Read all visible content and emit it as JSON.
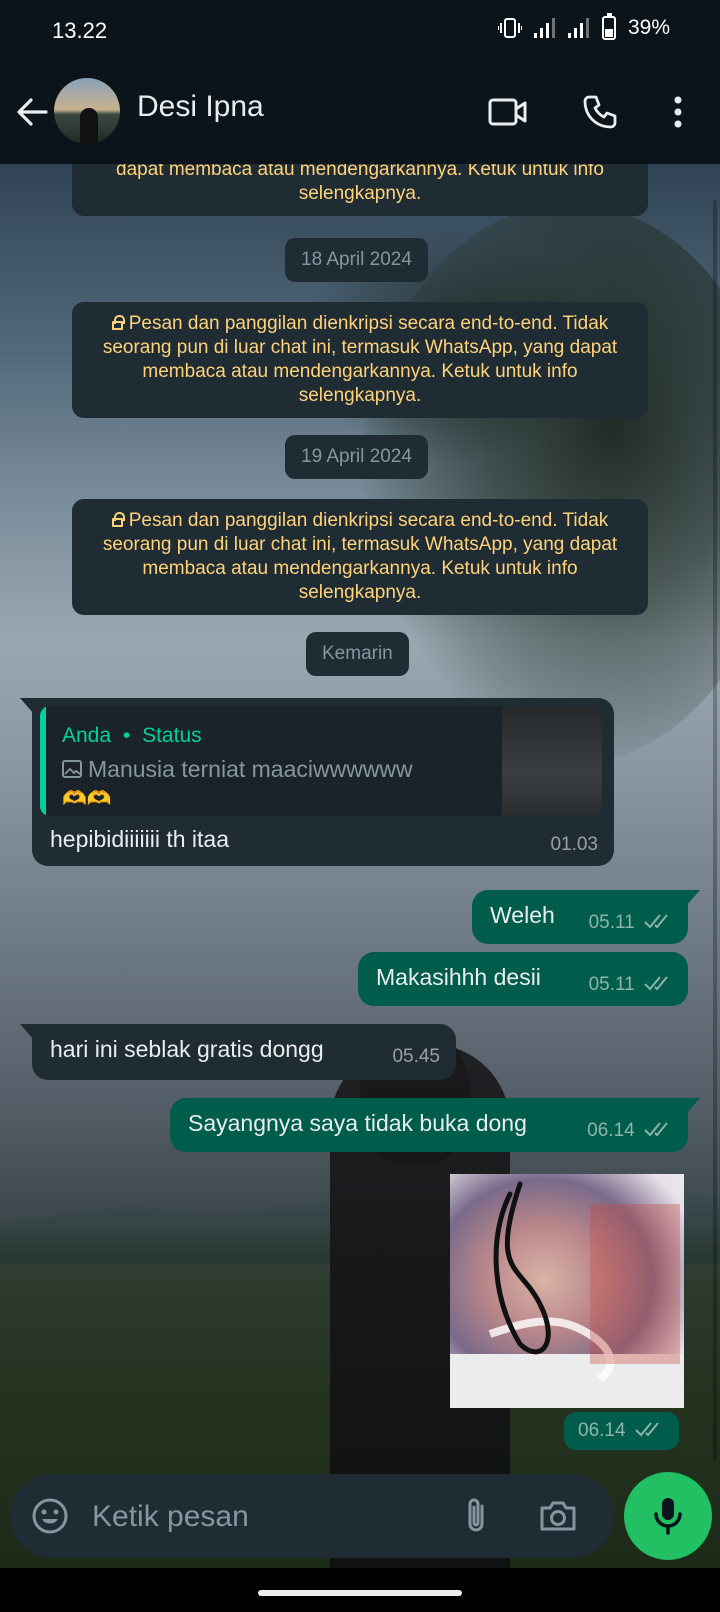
{
  "status_bar": {
    "time": "13.22",
    "battery": "39%"
  },
  "header": {
    "contact_name": "Desi Ipna"
  },
  "system_notice": {
    "partial_line1": "dapat membaca atau mendengarkannya. Ketuk untuk info",
    "partial_line2": "selengkapnya.",
    "full_text": "Pesan dan panggilan dienkripsi secara end-to-end. Tidak seorang pun di luar chat ini, termasuk WhatsApp, yang dapat membaca atau mendengarkannya. Ketuk untuk info selengkapnya."
  },
  "dates": {
    "d1": "18 April 2024",
    "d2": "19 April 2024",
    "d3": "Kemarin"
  },
  "messages": {
    "reply": {
      "quote_author": "Anda",
      "quote_source": "Status",
      "quote_text": "Manusia terniat maaciwwwwww",
      "quote_emoji": "🫶🫶",
      "text": "hepibidiiiiiii th itaa",
      "time": "01.03"
    },
    "m1": {
      "text": "Weleh",
      "time": "05.11"
    },
    "m2": {
      "text": "Makasihhh desii",
      "time": "05.11"
    },
    "m3": {
      "text": "hari ini seblak gratis dongg",
      "time": "05.45"
    },
    "m4": {
      "text": "Sayangnya saya tidak buka dong",
      "time": "06.14"
    },
    "m5": {
      "time": "06.14"
    }
  },
  "composer": {
    "placeholder": "Ketik pesan"
  },
  "colors": {
    "incoming": "#202c33",
    "outgoing": "#005c4b",
    "accent": "#21c063",
    "system_text": "#ffd279"
  }
}
